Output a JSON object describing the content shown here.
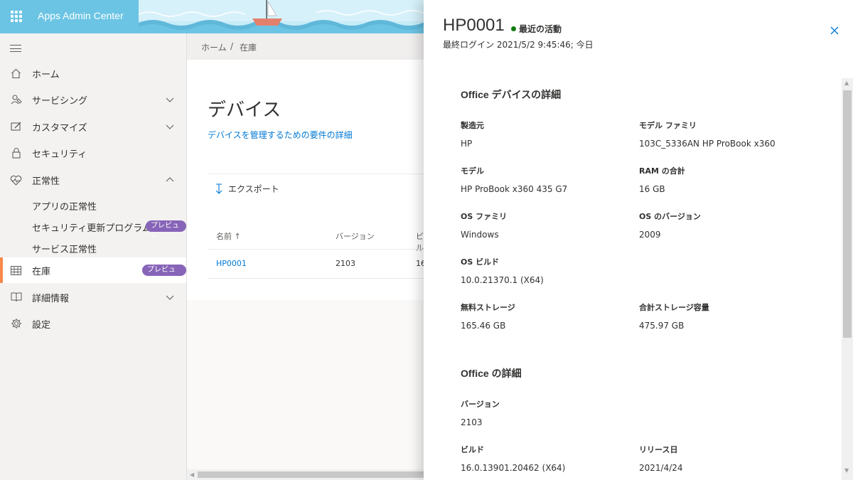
{
  "header": {
    "app_title": "Apps Admin Center"
  },
  "sidebar": {
    "items": [
      {
        "label": "ホーム",
        "icon": "home-icon"
      },
      {
        "label": "サービシング",
        "icon": "servicing-icon"
      },
      {
        "label": "カスタマイズ",
        "icon": "customize-icon"
      },
      {
        "label": "セキュリティ",
        "icon": "lock-icon"
      },
      {
        "label": "正常性",
        "icon": "heart-pulse-icon"
      },
      {
        "label": "在庫",
        "icon": "grid-icon",
        "badge": "プレビュー"
      },
      {
        "label": "詳細情報",
        "icon": "book-icon"
      },
      {
        "label": "設定",
        "icon": "gear-icon"
      }
    ],
    "health_sub": [
      {
        "label": "アプリの正常性"
      },
      {
        "label": "セキュリティ更新プログラム...",
        "badge": "プレビュー"
      },
      {
        "label": "サービス正常性"
      }
    ]
  },
  "breadcrumb": {
    "home": "ホーム",
    "separator": "/",
    "current": "在庫"
  },
  "main": {
    "title": "デバイス",
    "requirements_link": "デバイスを管理するための要件の詳細",
    "export_label": "エクスポート",
    "table": {
      "headers": {
        "name": "名前 ↑",
        "version": "バージョン",
        "build": "ビル"
      },
      "rows": [
        {
          "name": "HP0001",
          "version": "2103",
          "build": "16"
        }
      ]
    }
  },
  "panel": {
    "device_name": "HP0001",
    "status_text": "最近の活動",
    "status_color": "#107c10",
    "last_login": "最終ログイン 2021/5/2 9:45:46; 今日",
    "device_section": {
      "title": "Office デバイスの詳細",
      "manufacturer_label": "製造元",
      "manufacturer": "HP",
      "model_family_label": "モデル ファミリ",
      "model_family": "103C_5336AN HP ProBook x360",
      "model_label": "モデル",
      "model": "HP ProBook x360 435 G7",
      "ram_label": "RAM の合計",
      "ram": "16 GB",
      "os_family_label": "OS ファミリ",
      "os_family": "Windows",
      "os_version_label": "OS のバージョン",
      "os_version": "2009",
      "os_build_label": "OS ビルド",
      "os_build": "10.0.21370.1 (X64)",
      "free_storage_label": "無料ストレージ",
      "free_storage": "165.46 GB",
      "total_storage_label": "合計ストレージ容量",
      "total_storage": "475.97 GB"
    },
    "office_section": {
      "title": "Office の詳細",
      "version_label": "バージョン",
      "version": "2103",
      "build_label": "ビルド",
      "build": "16.0.13901.20462 (X64)",
      "release_label": "リリース日",
      "release_date": "2021/4/24"
    }
  },
  "colors": {
    "header": "#6cc4e4",
    "accent": "#f7894a",
    "link": "#0078d4",
    "badge": "#8764b8"
  }
}
